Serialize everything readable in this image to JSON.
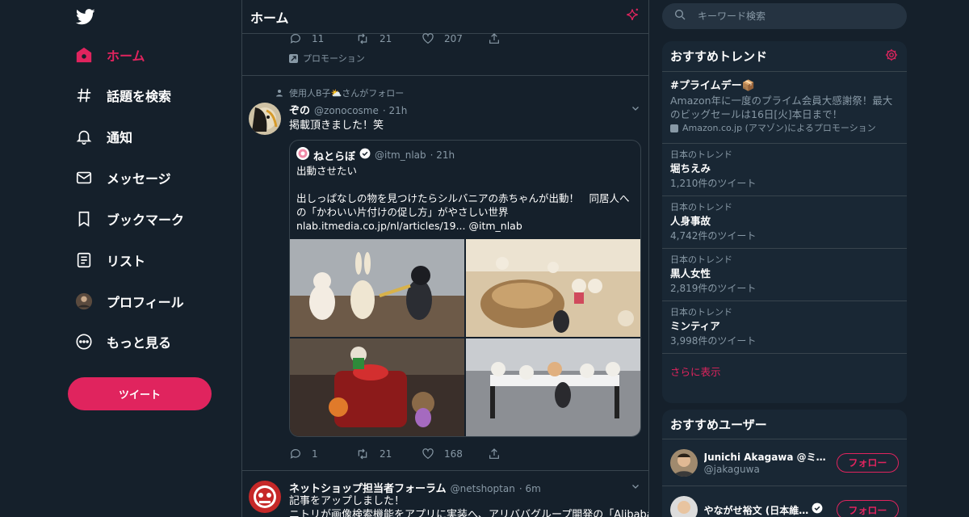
{
  "nav": {
    "items": [
      {
        "label": "ホーム",
        "icon": "home-icon",
        "active": true
      },
      {
        "label": "話題を検索",
        "icon": "hashtag-icon"
      },
      {
        "label": "通知",
        "icon": "bell-icon"
      },
      {
        "label": "メッセージ",
        "icon": "envelope-icon"
      },
      {
        "label": "ブックマーク",
        "icon": "bookmark-icon"
      },
      {
        "label": "リスト",
        "icon": "list-icon"
      },
      {
        "label": "プロフィール",
        "icon": "avatar-icon"
      },
      {
        "label": "もっと見る",
        "icon": "more-icon"
      }
    ],
    "tweet_button": "ツイート"
  },
  "timeline": {
    "title": "ホーム",
    "top_tweet": {
      "replies": "11",
      "retweets": "21",
      "likes": "207",
      "promotion": "プロモーション"
    },
    "tweet1": {
      "social_context": "使用人B子⛅さんがフォロー",
      "name": "ぞの",
      "handle": "@zonocosme",
      "time": "· 21h",
      "text": "掲載頂きました！笑",
      "quote": {
        "name": "ねとらぼ",
        "handle": "@itm_nlab",
        "time": "· 21h",
        "line1": "出動させたい",
        "line2": "出しっぱなしの物を見つけたらシルバニアの赤ちゃんが出動！　同居人への「かわいい片付けの促し方」がやさしい世界",
        "line3": "nlab.itmedia.co.jp/nl/articles/19... @itm_nlab"
      },
      "replies": "1",
      "retweets": "21",
      "likes": "168"
    },
    "tweet2": {
      "name": "ネットショップ担当者フォーラム",
      "handle": "@netshoptan",
      "time": "· 6m",
      "text1": "記事をアップしました！",
      "text2": "ニトリが画像検索機能をアプリに実装へ、アリババグループ開発の「Alibaba"
    }
  },
  "search": {
    "placeholder": "キーワード検索"
  },
  "trends": {
    "title": "おすすめトレンド",
    "promoted": {
      "name": "#プライムデー📦",
      "desc": "Amazon年に一度のプライム会員大感謝祭！最大のビッグセールは16日[火]本日まで！",
      "by": "Amazon.co.jp (アマゾン)によるプロモーション"
    },
    "items": [
      {
        "context": "日本のトレンド",
        "name": "堀ちえみ",
        "count": "1,210件のツイート"
      },
      {
        "context": "日本のトレンド",
        "name": "人身事故",
        "count": "4,742件のツイート"
      },
      {
        "context": "日本のトレンド",
        "name": "黒人女性",
        "count": "2,819件のツイート"
      },
      {
        "context": "日本のトレンド",
        "name": "ミンティア",
        "count": "3,998件のツイート"
      }
    ],
    "show_more": "さらに表示"
  },
  "who_to_follow": {
    "title": "おすすめユーザー",
    "users": [
      {
        "name": "Junichi Akagawa @ミ…",
        "handle": "@jakaguwa",
        "button": "フォロー"
      },
      {
        "name": "やながせ裕文 (日本維…",
        "handle": "",
        "button": "フォロー"
      }
    ]
  },
  "colors": {
    "accent": "#e0245e",
    "background": "#15202b",
    "panel": "#192734",
    "muted": "#8899a6",
    "border": "#38444d"
  }
}
